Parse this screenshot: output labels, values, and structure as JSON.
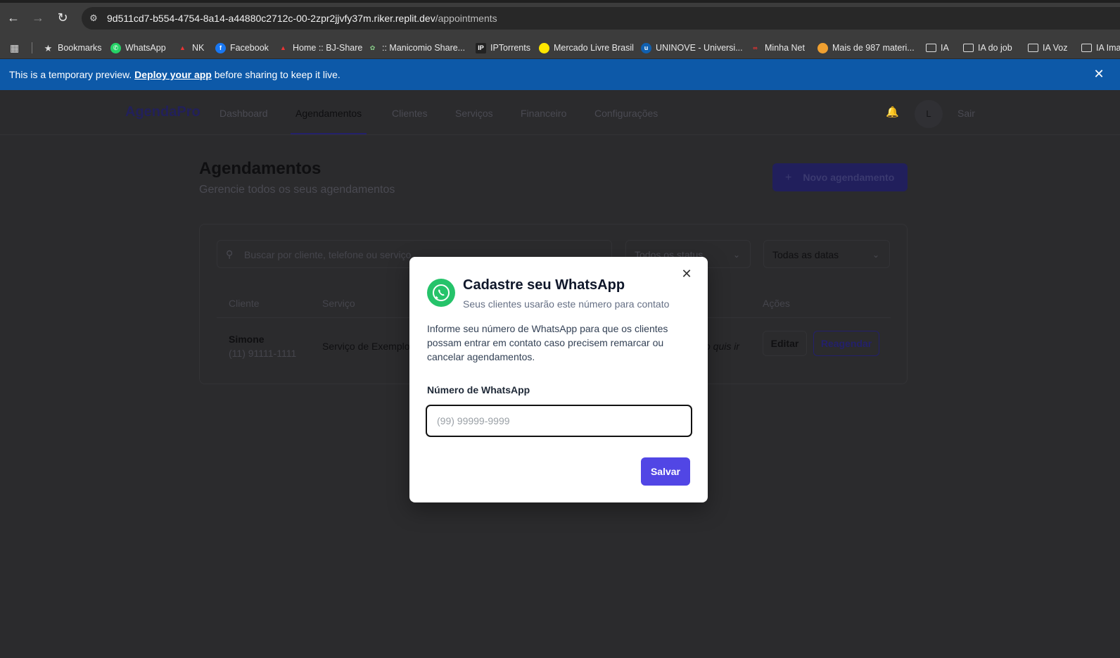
{
  "browser": {
    "url_host": "9d511cd7-b554-4754-8a14-a44880c2712c-00-2zpr2jjvfy37m.riker.replit.dev",
    "url_path": "/appointments",
    "bookmarks": [
      {
        "label": "Bookmarks",
        "icon": "star-icon"
      },
      {
        "label": "WhatsApp",
        "icon": "whatsapp-icon"
      },
      {
        "label": "NK",
        "icon": "nk-icon"
      },
      {
        "label": "Facebook",
        "icon": "facebook-icon"
      },
      {
        "label": "Home :: BJ-Share",
        "icon": "bjshare-icon"
      },
      {
        "label": ":: Manicomio Share...",
        "icon": "manicomio-icon"
      },
      {
        "label": "IPTorrents",
        "icon": "iptorrents-icon"
      },
      {
        "label": "Mercado Livre Brasil",
        "icon": "mercadolivre-icon"
      },
      {
        "label": "UNINOVE - Universi...",
        "icon": "uninove-icon"
      },
      {
        "label": "Minha Net",
        "icon": "minhanet-icon"
      },
      {
        "label": "Mais de 987 materi...",
        "icon": "materials-icon"
      },
      {
        "label": "IA",
        "icon": "folder-icon"
      },
      {
        "label": "IA do job",
        "icon": "folder-icon"
      },
      {
        "label": "IA Voz",
        "icon": "folder-icon"
      },
      {
        "label": "IA Ima",
        "icon": "folder-icon"
      }
    ]
  },
  "banner": {
    "prefix": "This is a temporary preview. ",
    "link": "Deploy your app",
    "suffix": " before sharing to keep it live."
  },
  "app": {
    "logo": "AgendaPro",
    "nav": [
      "Dashboard",
      "Agendamentos",
      "Clientes",
      "Serviços",
      "Financeiro",
      "Configurações"
    ],
    "avatar_initial": "L",
    "logout": "Sair",
    "page_title": "Agendamentos",
    "page_subtitle": "Gerencie todos os seus agendamentos",
    "new_button": "Novo agendamento",
    "search_placeholder": "Buscar por cliente, telefone ou serviço...",
    "status_filter": "Todos os status",
    "date_filter": "Todas as datas",
    "table": {
      "headers": {
        "client": "Cliente",
        "service": "Serviço",
        "actions": "Ações"
      },
      "row": {
        "client_name": "Simone",
        "client_phone": "(11) 91111-1111",
        "service": "Serviço de Exemplo",
        "note_fragment": "o quis ir",
        "edit": "Editar",
        "reschedule": "Reagendar"
      }
    }
  },
  "modal": {
    "title": "Cadastre seu WhatsApp",
    "subtitle": "Seus clientes usarão este número para contato",
    "description": "Informe seu número de WhatsApp para que os clientes possam entrar em contato caso precisem remarcar ou cancelar agendamentos.",
    "field_label": "Número de WhatsApp",
    "field_placeholder": "(99) 99999-9999",
    "field_value": "",
    "save": "Salvar"
  },
  "colors": {
    "banner": "#0d59a8",
    "primary": "#5146e5",
    "whatsapp": "#25c36a"
  }
}
